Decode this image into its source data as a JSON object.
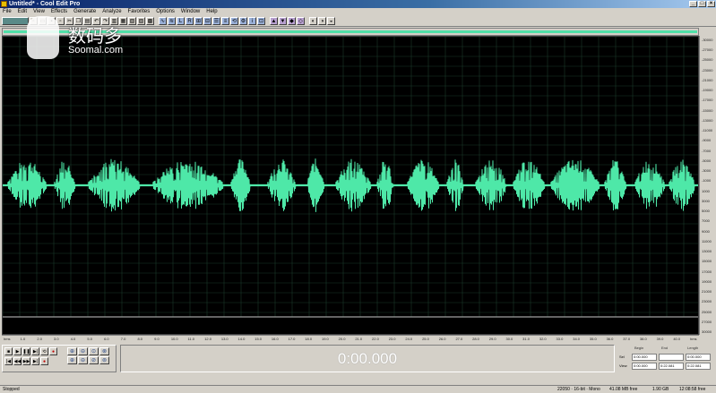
{
  "window": {
    "title": "Untitled* - Cool Edit Pro"
  },
  "menu": [
    "File",
    "Edit",
    "View",
    "Effects",
    "Generate",
    "Analyze",
    "Favorites",
    "Options",
    "Window",
    "Help"
  ],
  "watermark": {
    "chinese": "数码多",
    "english": "Soomal.com"
  },
  "amplitude_labels": [
    "-30000",
    "-27000",
    "-25000",
    "-23000",
    "-21000",
    "-19000",
    "-17000",
    "-15000",
    "-13000",
    "-11000",
    "-9000",
    "-7000",
    "-5000",
    "-3000",
    "-1000",
    "1000",
    "3000",
    "5000",
    "7000",
    "9000",
    "11000",
    "13000",
    "15000",
    "17000",
    "19000",
    "21000",
    "23000",
    "25000",
    "27000",
    "30000"
  ],
  "time_labels": [
    "hms",
    "1.0",
    "2.0",
    "3.0",
    "4.0",
    "5.0",
    "6.0",
    "7.0",
    "8.0",
    "9.0",
    "10.0",
    "11.0",
    "12.0",
    "13.0",
    "14.0",
    "15.0",
    "16.0",
    "17.0",
    "18.0",
    "19.0",
    "20.0",
    "21.0",
    "22.0",
    "23.0",
    "24.0",
    "25.0",
    "26.0",
    "27.0",
    "28.0",
    "29.0",
    "30.0",
    "31.0",
    "32.0",
    "33.0",
    "34.0",
    "35.0",
    "36.0",
    "37.0",
    "38.0",
    "39.0",
    "40.0",
    "hms"
  ],
  "time_display": "0:00.000",
  "selection": {
    "headers": [
      "Begin",
      "End",
      "Length"
    ],
    "rows": [
      {
        "label": "Sel",
        "values": [
          "0:00.000",
          "",
          "0:00.000"
        ]
      },
      {
        "label": "View",
        "values": [
          "0:00.000",
          "0:22.081",
          "0:22.081"
        ]
      }
    ]
  },
  "status": {
    "state": "Stopped",
    "format": "22050 · 16-bit · Mono",
    "size": "41.08 MB free",
    "disk": "1.90 GB",
    "free_time": "12:08:58 free"
  },
  "colors": {
    "waveform": "#4ee8a8",
    "background": "#000000",
    "grid": "#1a3a2a",
    "centerline": "#c0c0c0"
  }
}
